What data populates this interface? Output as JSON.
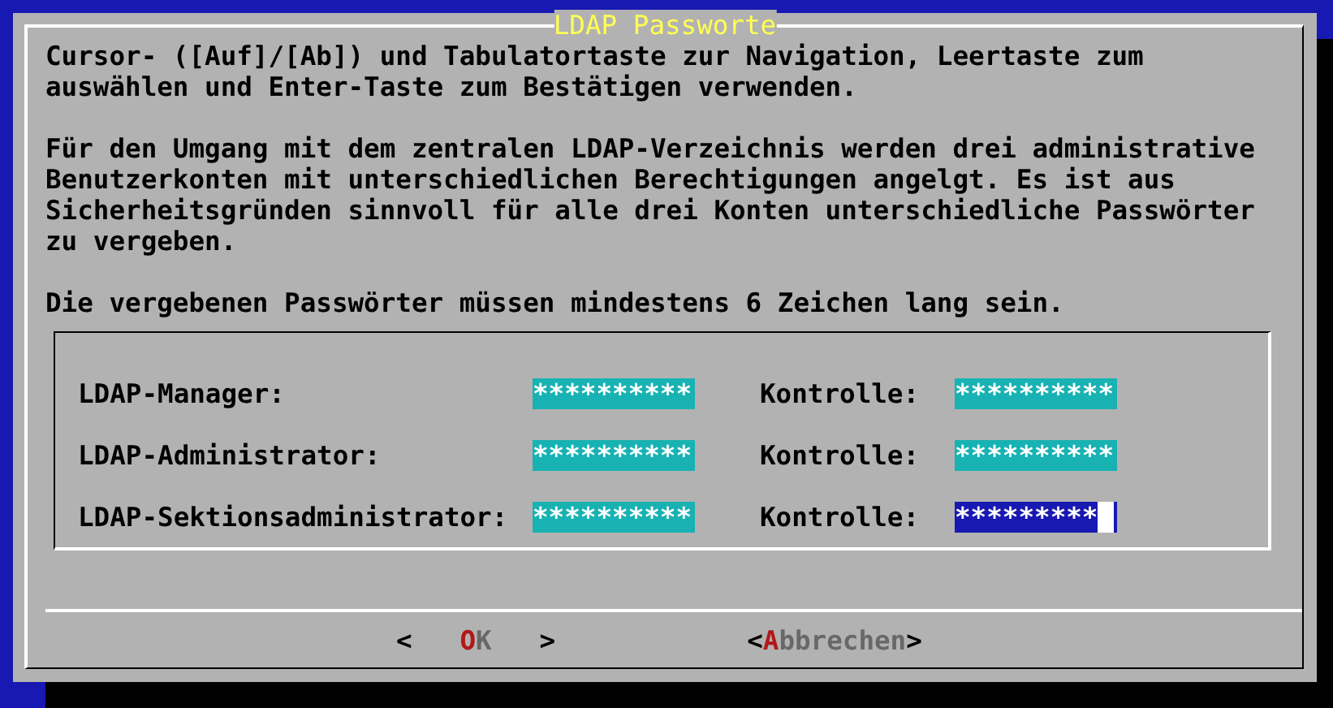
{
  "dialog": {
    "title": "LDAP Passworte",
    "paragraphs": [
      "Cursor- ([Auf]/[Ab]) und Tabulatortaste zur Navigation, Leertaste zum auswählen und Enter-Taste zum Bestätigen verwenden.",
      "Für den Umgang mit dem zentralen LDAP-Verzeichnis werden drei administrative Benutzerkonten mit unterschiedlichen Berechtigungen angelgt. Es ist aus Sicherheitsgründen sinnvoll für alle drei Konten unterschiedliche Passwörter zu vergeben.",
      "Die vergebenen Passwörter müssen mindestens 6 Zeichen lang sein."
    ],
    "fields": [
      {
        "label": "LDAP-Manager:",
        "password": "**********",
        "password_focused": false,
        "confirm_label": "Kontrolle:",
        "confirm": "**********",
        "confirm_focused": false
      },
      {
        "label": "LDAP-Administrator:",
        "password": "**********",
        "password_focused": false,
        "confirm_label": "Kontrolle:",
        "confirm": "**********",
        "confirm_focused": false
      },
      {
        "label": "LDAP-Sektionsadministrator:",
        "password": "**********",
        "password_focused": false,
        "confirm_label": "Kontrolle:",
        "confirm": "*********",
        "confirm_focused": true
      }
    ],
    "buttons": [
      {
        "open": "<",
        "hotkey": "O",
        "rest": "K",
        "close": ">",
        "selected": false
      },
      {
        "open": "<",
        "hotkey": "A",
        "rest": "bbrechen",
        "close": ">",
        "selected": false
      }
    ]
  }
}
